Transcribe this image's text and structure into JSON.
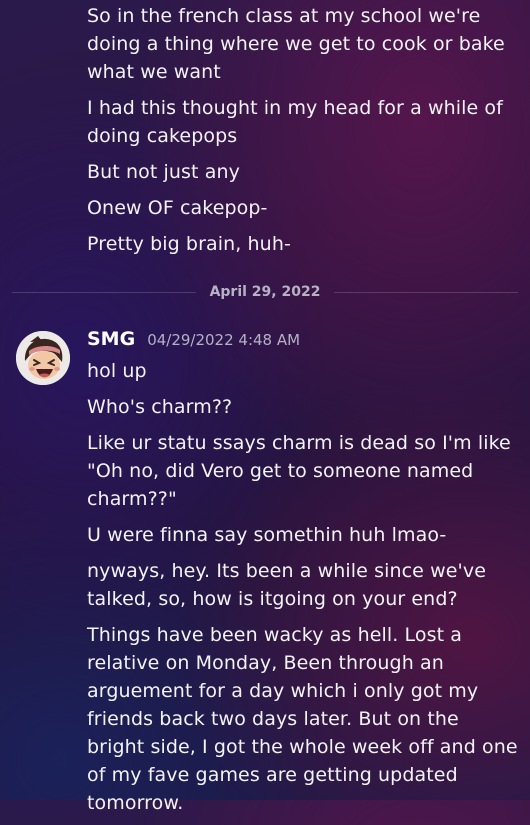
{
  "top_messages": [
    "So in the french class at my school we're doing a thing where we get to cook or bake what we want",
    "I had this thought in my head for a while of doing cakepops",
    "But not just any",
    "Onew OF cakepop-",
    "Pretty big brain, huh-"
  ],
  "divider": {
    "date": "April 29, 2022"
  },
  "message": {
    "username": "SMG",
    "timestamp": "04/29/2022 4:48 AM",
    "avatar_icon": "cartoon-face-avatar",
    "lines": [
      "hol up",
      "Who's charm??",
      "Like ur statu ssays charm is dead so I'm like \"Oh no, did Vero get to someone named charm??\"",
      "U were finna say somethin huh lmao-",
      "nyways, hey. Its been a while since we've talked, so, how is itgoing on your end?",
      "Things have been wacky as hell. Lost a relative on Monday, Been through an arguement for a day which i only got my friends back two days later. But on the bright side, I got the whole week off and one of my fave games are getting updated tomorrow."
    ]
  },
  "colors": {
    "text": "#f2f3f5",
    "timestamp": "#b4b1c4",
    "divider_text": "#b5b3c3"
  }
}
